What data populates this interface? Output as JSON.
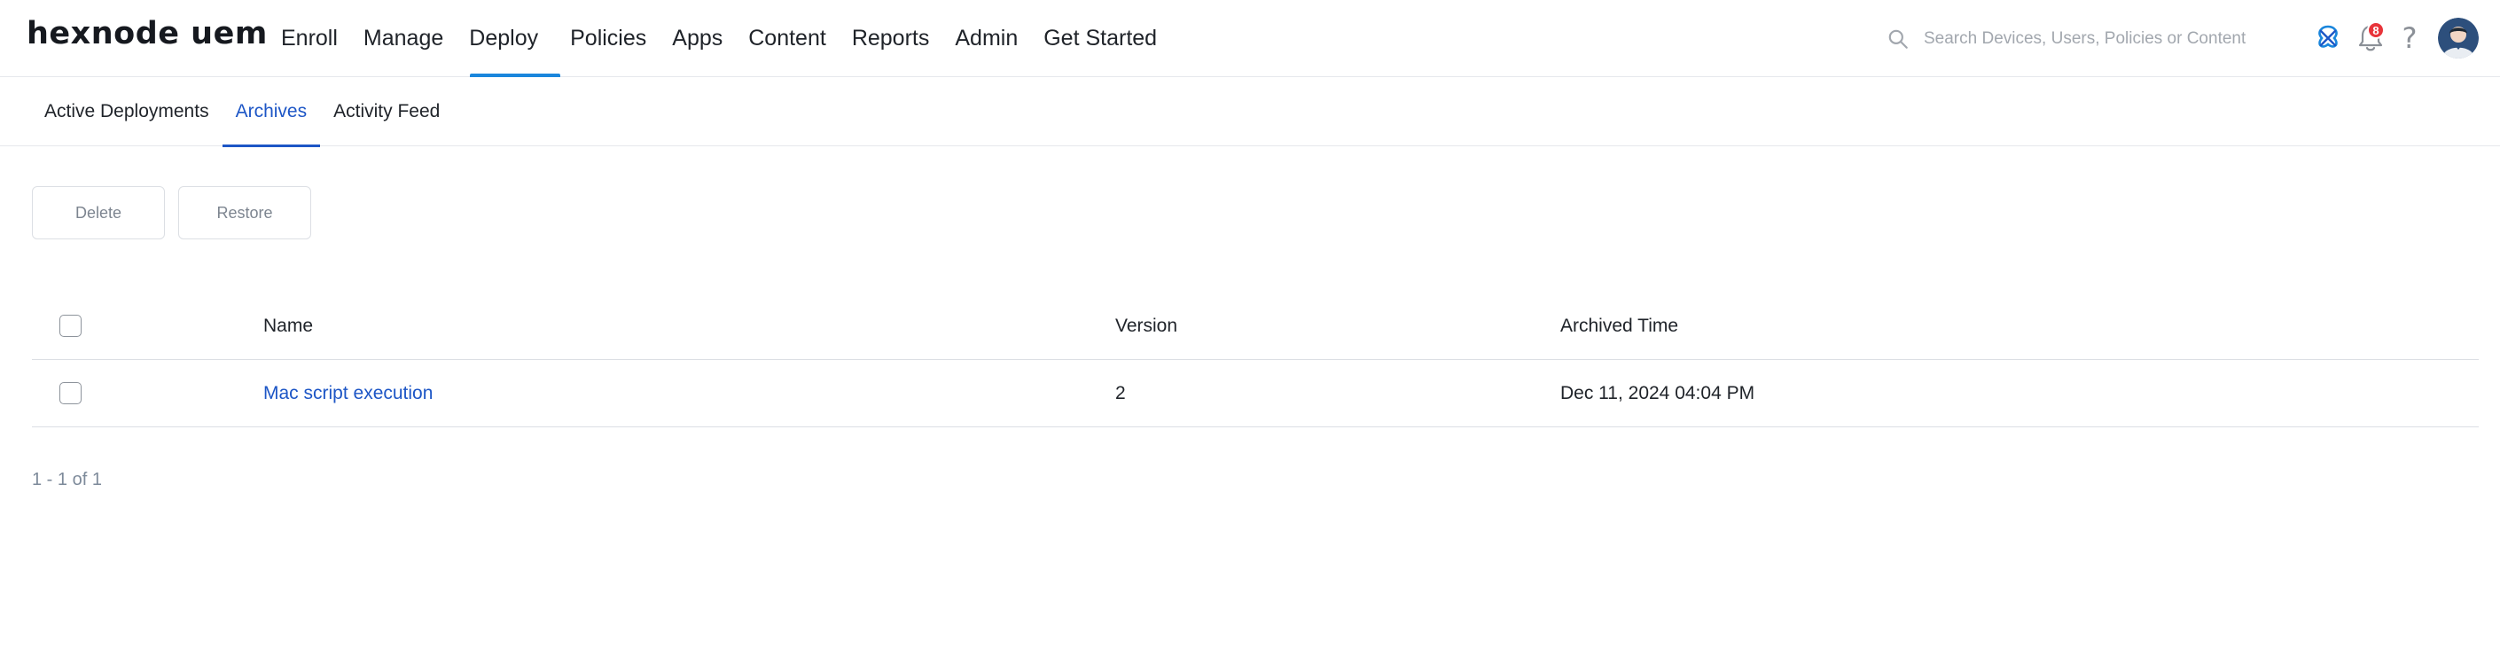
{
  "brand": {
    "logo_text": "hexnode uem"
  },
  "main_nav": {
    "items": [
      {
        "label": "Enroll",
        "active": false
      },
      {
        "label": "Manage",
        "active": false
      },
      {
        "label": "Deploy",
        "active": true
      },
      {
        "label": "Policies",
        "active": false
      },
      {
        "label": "Apps",
        "active": false
      },
      {
        "label": "Content",
        "active": false
      },
      {
        "label": "Reports",
        "active": false
      },
      {
        "label": "Admin",
        "active": false
      },
      {
        "label": "Get Started",
        "active": false
      }
    ]
  },
  "search": {
    "placeholder": "Search Devices, Users, Policies or Content",
    "value": ""
  },
  "header_icons": {
    "apps_icon": "apps-icon",
    "notifications_icon": "bell-icon",
    "notification_count": "8",
    "help_icon": "help-icon",
    "help_glyph": "?",
    "avatar": "user-avatar"
  },
  "sub_tabs": [
    {
      "label": "Active Deployments",
      "active": false
    },
    {
      "label": "Archives",
      "active": true
    },
    {
      "label": "Activity Feed",
      "active": false
    }
  ],
  "actions": {
    "delete_label": "Delete",
    "restore_label": "Restore"
  },
  "table": {
    "columns": {
      "name": "Name",
      "version": "Version",
      "archived_time": "Archived Time"
    },
    "rows": [
      {
        "name": "Mac script execution",
        "version": "2",
        "archived_time": "Dec 11, 2024 04:04 PM"
      }
    ]
  },
  "pagination": {
    "summary": "1 - 1 of 1"
  },
  "colors": {
    "accent": "#1a86dc",
    "link": "#1d56c6",
    "badge": "#e8343a",
    "border": "#dcdfe4"
  }
}
